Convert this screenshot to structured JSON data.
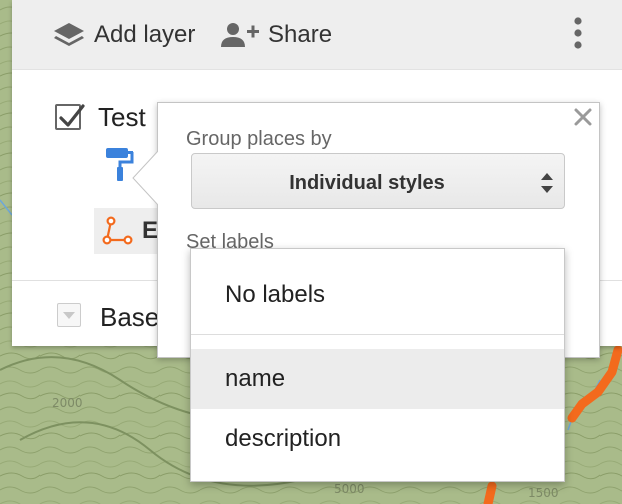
{
  "toolbar": {
    "add_layer_label": "Add layer",
    "share_label": "Share"
  },
  "layer": {
    "title": "Test",
    "checked": true,
    "dataset_label": "E"
  },
  "base_map": {
    "label": "Base"
  },
  "popup": {
    "group_label": "Group places by",
    "group_value": "Individual styles",
    "labels_label": "Set labels"
  },
  "labels_menu": {
    "items": [
      "No labels",
      "name",
      "description"
    ],
    "highlighted": "name"
  },
  "map": {
    "contour_labels": [
      "2000",
      "5000",
      "1500"
    ]
  },
  "colors": {
    "route": "#f36a1d",
    "accent_blue": "#3b82dc",
    "terrain": "#a9bb8a"
  },
  "icons": {
    "add_layer": "layers-icon",
    "share": "add-person-icon",
    "more": "more-vert-icon",
    "style": "paint-roller-icon",
    "dataset": "line-path-icon",
    "close": "close-icon",
    "select": "up-down-arrows-icon",
    "base_toggle": "caret-down-icon"
  }
}
